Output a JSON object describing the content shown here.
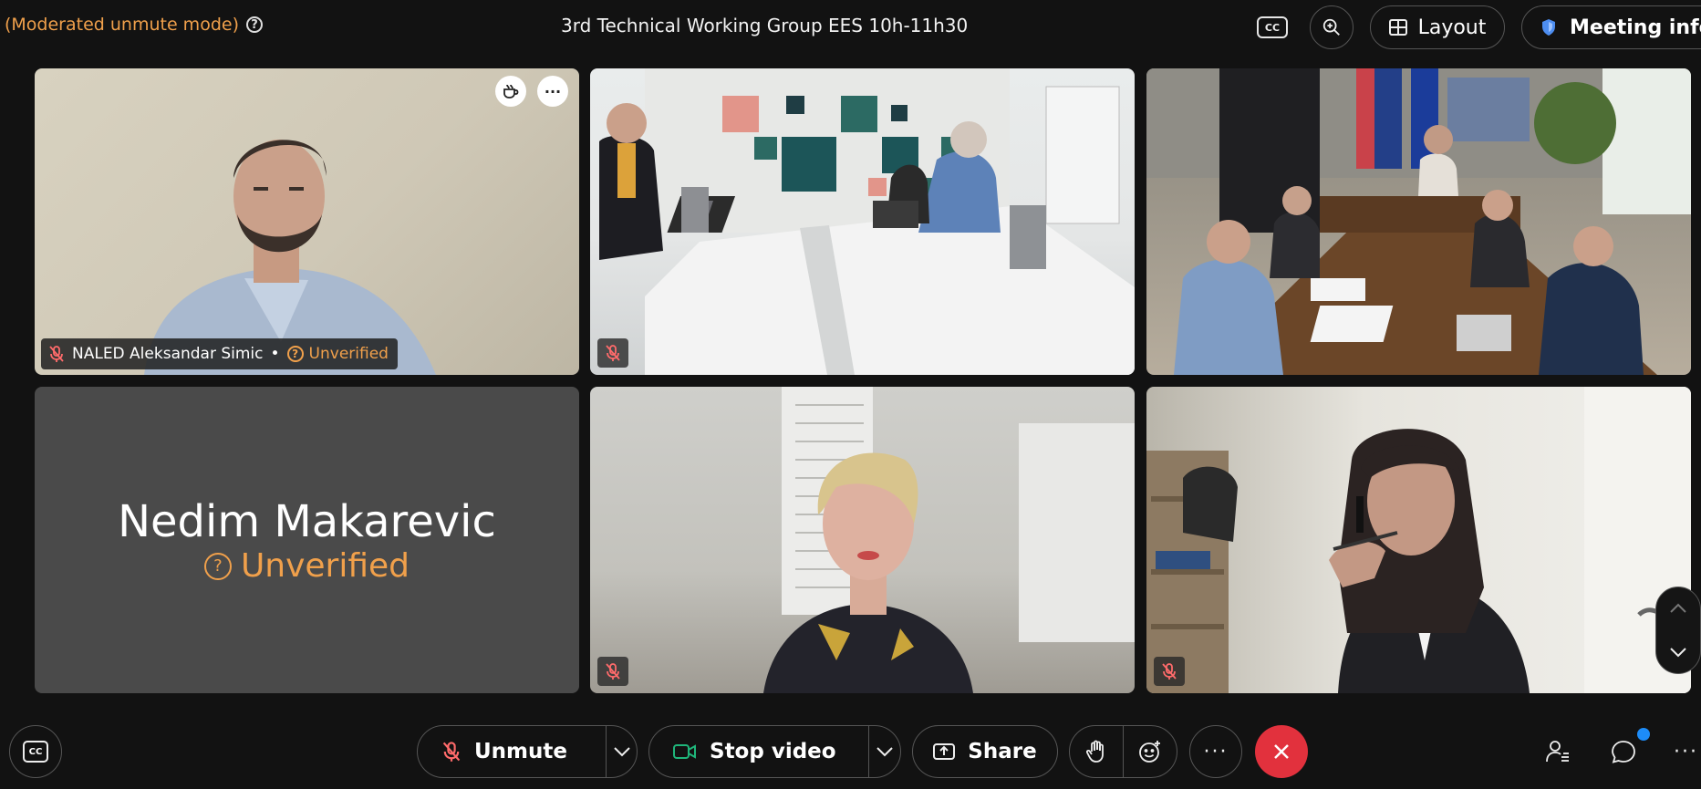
{
  "header": {
    "moderated_label": "(Moderated unmute mode)",
    "meeting_title": "3rd Technical Working Group EES 10h-11h30",
    "cc_label": "CC",
    "layout_label": "Layout",
    "meeting_info_label": "Meeting info"
  },
  "tiles": {
    "t1": {
      "name": "NALED Aleksandar Simic",
      "separator": "•",
      "status": "Unverified"
    },
    "t4": {
      "name": "Nedim Makarevic",
      "status": "Unverified"
    }
  },
  "toolbar": {
    "unmute_label": "Unmute",
    "stop_video_label": "Stop video",
    "share_label": "Share",
    "more_label": "···"
  },
  "colors": {
    "accent_orange": "#f0a04b",
    "end_call_red": "#e2313d",
    "notification_blue": "#1d8cf8",
    "video_green": "#1fb57a"
  },
  "icons": [
    "help-icon",
    "cc-icon",
    "zoom-icon",
    "layout-icon",
    "shield-icon",
    "mic-muted-icon",
    "coffee-icon",
    "more-icon",
    "camera-icon",
    "chevron-down-icon",
    "share-icon",
    "hand-icon",
    "emoji-icon",
    "close-icon",
    "participants-icon",
    "chat-icon",
    "chevron-up-icon"
  ]
}
